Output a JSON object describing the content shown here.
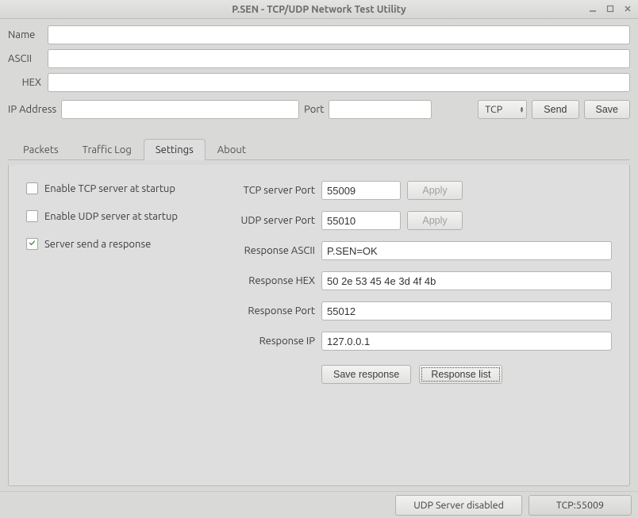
{
  "window": {
    "title": "P.SEN - TCP/UDP Network Test Utility"
  },
  "top": {
    "name_label": "Name",
    "ascii_label": "ASCII",
    "hex_label": "HEX",
    "name_value": "",
    "ascii_value": "",
    "hex_value": ""
  },
  "conn": {
    "ip_label": "IP Address",
    "ip_value": "",
    "port_label": "Port",
    "port_value": "",
    "proto": "TCP",
    "send_label": "Send",
    "save_label": "Save"
  },
  "tabs": {
    "packets": "Packets",
    "traffic": "Traffic Log",
    "settings": "Settings",
    "about": "About"
  },
  "settings": {
    "tcp_startup_label": "Enable TCP server at startup",
    "udp_startup_label": "Enable UDP server at startup",
    "send_response_label": "Server send a response",
    "tcp_startup_checked": false,
    "udp_startup_checked": false,
    "send_response_checked": true,
    "tcp_port_label": "TCP server Port",
    "tcp_port_value": "55009",
    "udp_port_label": "UDP server Port",
    "udp_port_value": "55010",
    "apply_label": "Apply",
    "resp_ascii_label": "Response ASCII",
    "resp_ascii_value": "P.SEN=OK",
    "resp_hex_label": "Response HEX",
    "resp_hex_value": "50 2e 53 45 4e 3d 4f 4b",
    "resp_port_label": "Response Port",
    "resp_port_value": "55012",
    "resp_ip_label": "Response IP",
    "resp_ip_value": "127.0.0.1",
    "save_response_label": "Save response",
    "response_list_label": "Response list"
  },
  "status": {
    "udp": "UDP Server disabled",
    "tcp": "TCP:55009"
  }
}
